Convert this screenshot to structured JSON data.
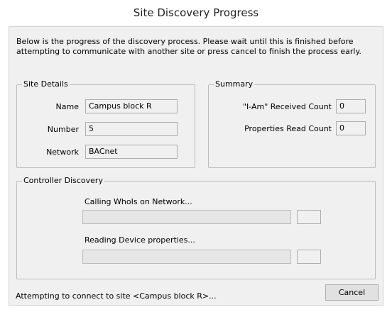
{
  "window": {
    "title": "Site Discovery Progress"
  },
  "intro_text": "Below is the progress of the discovery process. Please wait until this is finished before attempting to communicate with another site or press cancel to finish the process early.",
  "site_details": {
    "legend": "Site Details",
    "name_label": "Name",
    "name_value": "Campus block R",
    "number_label": "Number",
    "number_value": "5",
    "network_label": "Network",
    "network_value": "BACnet"
  },
  "summary": {
    "legend": "Summary",
    "iam_label": "\"I-Am\" Received Count",
    "iam_value": "0",
    "props_label": "Properties Read Count",
    "props_value": "0"
  },
  "controller_discovery": {
    "legend": "Controller Discovery",
    "whois_label": "Calling WhoIs on Network...",
    "whois_progress": 0,
    "whois_count": "",
    "reading_label": "Reading Device properties...",
    "reading_progress": 0,
    "reading_count": ""
  },
  "status_text": "Attempting to connect to site <Campus block R>...",
  "buttons": {
    "cancel": "Cancel"
  }
}
